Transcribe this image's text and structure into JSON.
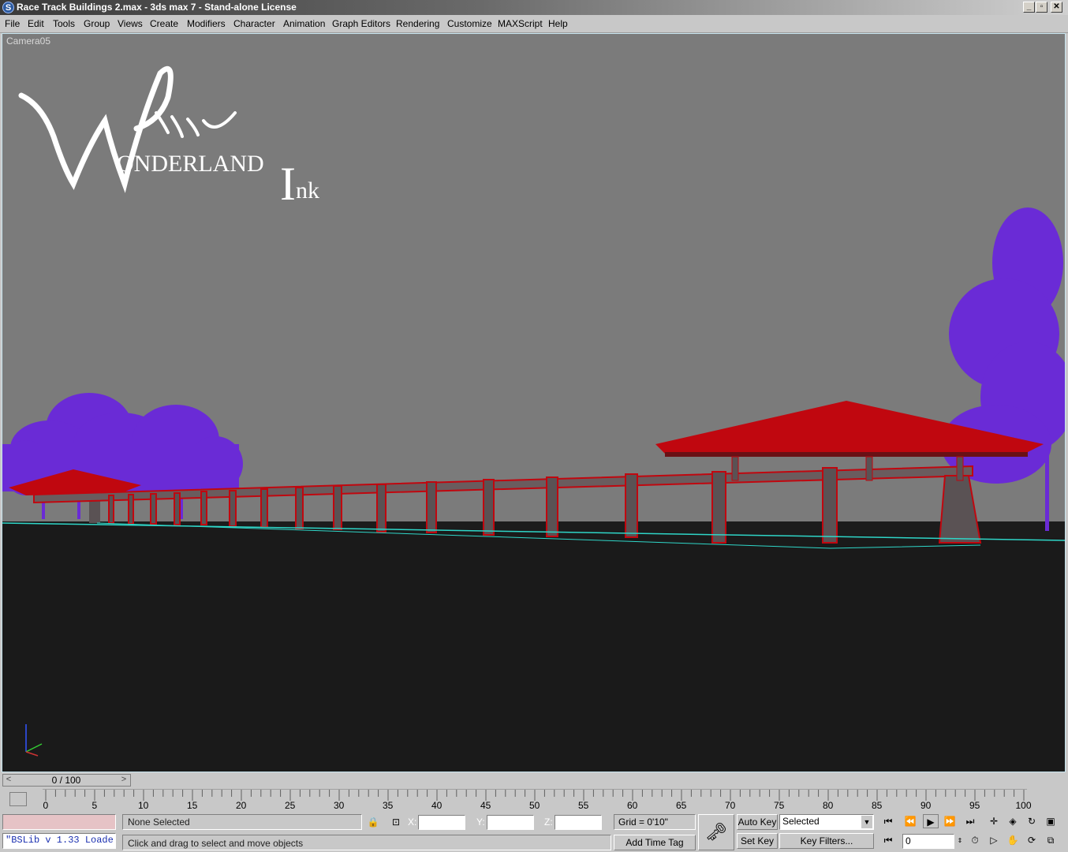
{
  "window": {
    "title": "Race Track Buildings 2.max - 3ds max 7  - Stand-alone License",
    "buttons": [
      "_",
      "▫",
      "✕"
    ]
  },
  "menu": [
    "File",
    "Edit",
    "Tools",
    "Group",
    "Views",
    "Create",
    "Modifiers",
    "Character",
    "Animation",
    "Graph Editors",
    "Rendering",
    "Customize",
    "MAXScript",
    "Help"
  ],
  "viewport": {
    "label": "Camera05",
    "logo": {
      "line1": "ONDERLAND",
      "big_w": "W",
      "big_i": "I",
      "line2": "nk"
    },
    "colors": {
      "sky": "#7b7b7b",
      "ground": "#1a1a1a",
      "roof": "#c0070f",
      "trees": "#6a2bd6",
      "wire": "#2fd6c8",
      "pillar": "#5a5254"
    }
  },
  "time": {
    "slider_label": "0 / 100",
    "prev": "<",
    "next": ">"
  },
  "ruler": {
    "labels": [
      "0",
      "5",
      "10",
      "15",
      "20",
      "25",
      "30",
      "35",
      "40",
      "45",
      "50",
      "55",
      "60",
      "65",
      "70",
      "75",
      "80",
      "85",
      "90",
      "95",
      "100"
    ]
  },
  "status": {
    "selection": "None Selected",
    "prompt": "Click and drag to select and move objects",
    "listener": "\"BSLib v 1.33 Loade",
    "x_label": "X:",
    "y_label": "Y:",
    "z_label": "Z:",
    "grid": "Grid = 0'10\"",
    "add_time_tag": "Add Time Tag",
    "auto_key": "Auto Key",
    "set_key": "Set Key",
    "key_mode": "Selected",
    "key_filters": "Key Filters...",
    "frame": "0"
  }
}
